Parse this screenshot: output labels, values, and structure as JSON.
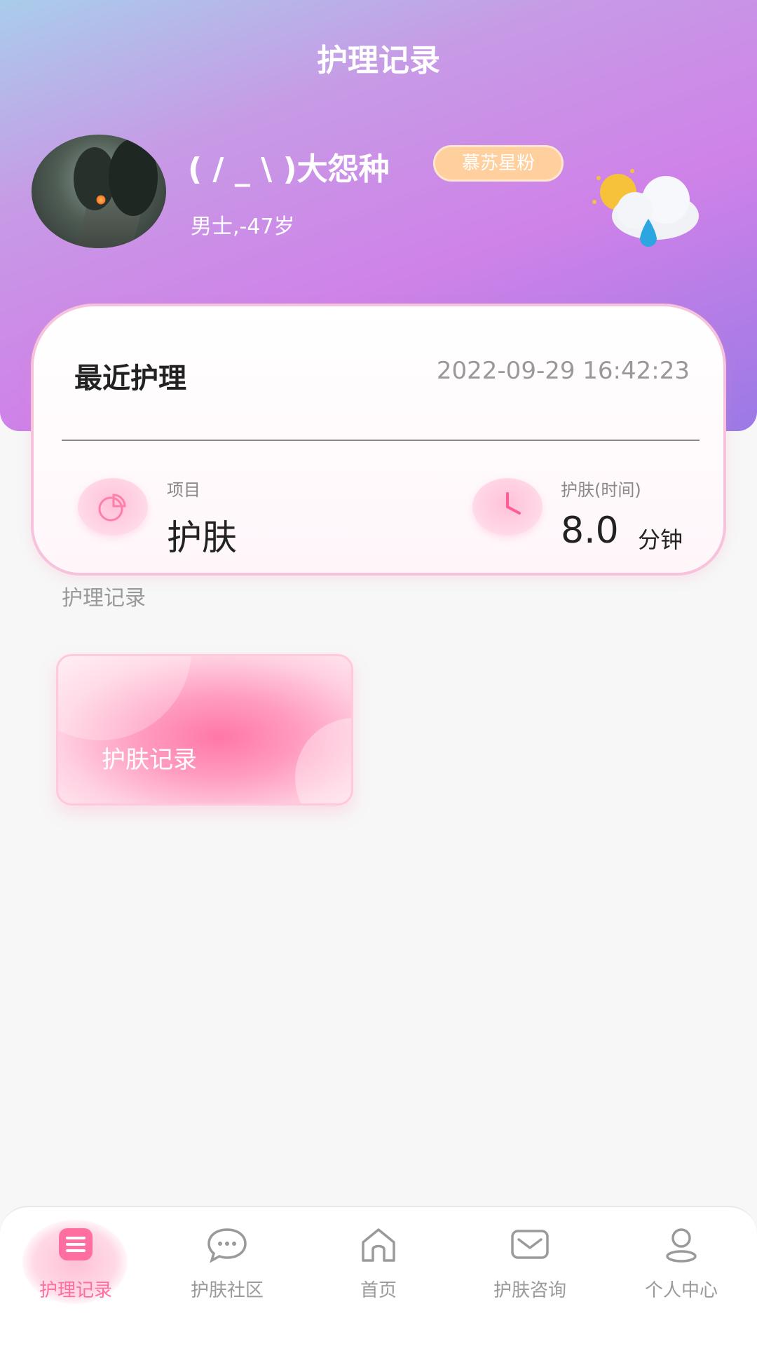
{
  "header": {
    "title": "护理记录"
  },
  "profile": {
    "username": "( / _ \\ )大怨种",
    "badge": "慕苏星粉",
    "meta": "男士,-47岁"
  },
  "recent": {
    "title": "最近护理",
    "timestamp": "2022-09-29 16:42:23",
    "project_label": "项目",
    "project_value": "护肤",
    "time_label": "护肤(时间)",
    "time_value": "8.0",
    "time_unit": "分钟"
  },
  "records": {
    "section_label": "护理记录",
    "tile_label": "护肤记录"
  },
  "tabbar": {
    "items": [
      {
        "label": "护理记录",
        "icon": "list-icon",
        "active": true
      },
      {
        "label": "护肤社区",
        "icon": "chat-icon",
        "active": false
      },
      {
        "label": "首页",
        "icon": "home-icon",
        "active": false
      },
      {
        "label": "护肤咨询",
        "icon": "mail-icon",
        "active": false
      },
      {
        "label": "个人中心",
        "icon": "user-icon",
        "active": false
      }
    ]
  },
  "colors": {
    "accent": "#ff6ea0",
    "badge": "#ffcf9e"
  }
}
